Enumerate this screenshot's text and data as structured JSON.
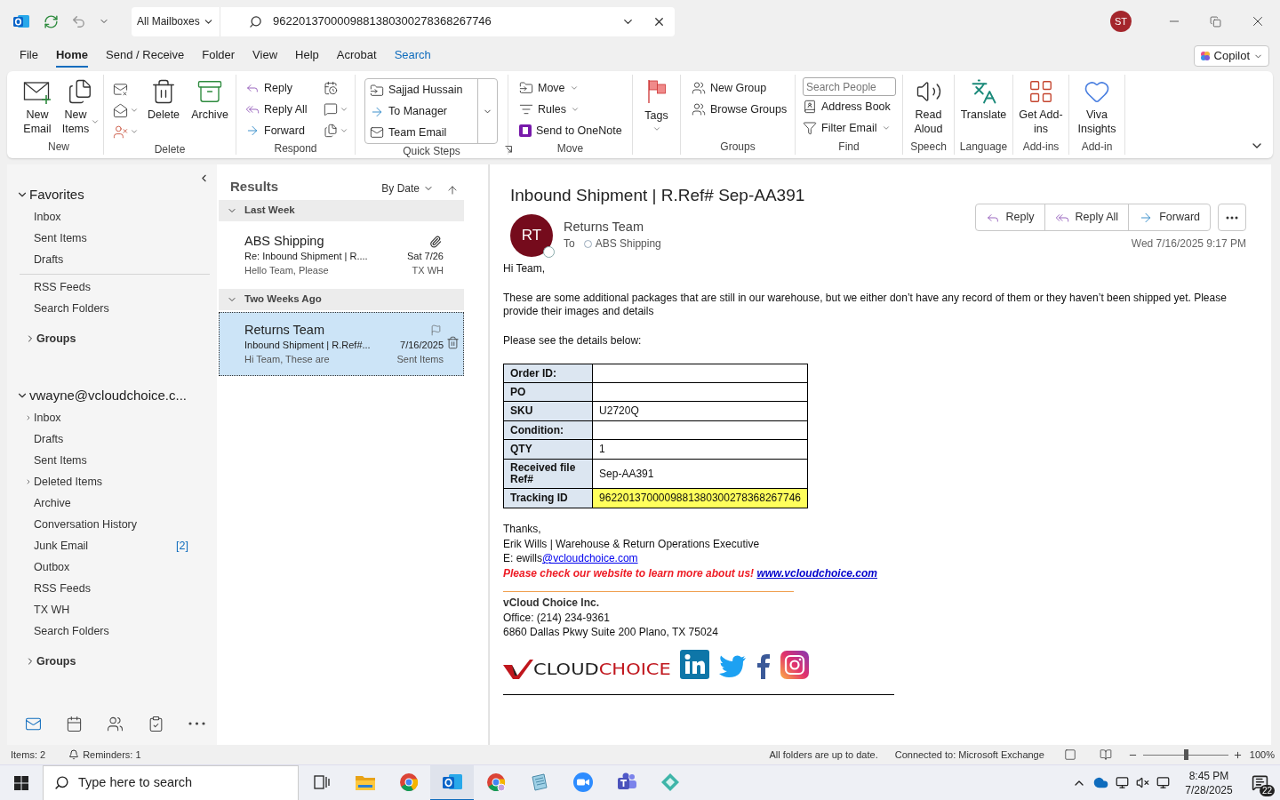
{
  "title_bar": {
    "search_scope": "All Mailboxes",
    "search_value": "9622013700009881380300278368267746",
    "account_initials": "ST"
  },
  "menu_tabs": [
    {
      "label": "File",
      "selected": false,
      "kind": "standard"
    },
    {
      "label": "Home",
      "selected": true,
      "kind": "standard"
    },
    {
      "label": "Send / Receive",
      "selected": false,
      "kind": "standard"
    },
    {
      "label": "Folder",
      "selected": false,
      "kind": "standard"
    },
    {
      "label": "View",
      "selected": false,
      "kind": "standard"
    },
    {
      "label": "Help",
      "selected": false,
      "kind": "standard"
    },
    {
      "label": "Acrobat",
      "selected": false,
      "kind": "standard"
    },
    {
      "label": "Search",
      "selected": false,
      "kind": "contextual"
    }
  ],
  "copilot": {
    "label": "Copilot"
  },
  "ribbon": {
    "groups": [
      {
        "label": "New",
        "kind": "large",
        "buttons": [
          "New Email",
          "New Items"
        ]
      },
      {
        "label": "Delete",
        "kind": "delete",
        "buttons": [
          "Delete",
          "Archive"
        ]
      },
      {
        "label": "Respond",
        "kind": "respond",
        "buttons": [
          "Reply",
          "Reply All",
          "Forward"
        ]
      },
      {
        "label": "Quick Steps",
        "kind": "gallery",
        "buttons": [
          "Sajjad Hussain",
          "To Manager",
          "Team Email"
        ]
      },
      {
        "label": "Move",
        "kind": "small",
        "buttons": [
          "Move",
          "Rules",
          "Send to OneNote"
        ]
      },
      {
        "kind": "tags",
        "buttons": [
          "Tags"
        ]
      },
      {
        "label": "Groups",
        "kind": "small",
        "buttons": [
          "New Group",
          "Browse Groups"
        ]
      },
      {
        "label": "Find",
        "kind": "find",
        "placeholder": "Search People",
        "buttons": [
          "Address Book",
          "Filter Email"
        ]
      },
      {
        "label": "Speech",
        "kind": "large",
        "buttons": [
          "Read Aloud"
        ]
      },
      {
        "label": "Language",
        "kind": "large",
        "buttons": [
          "Translate"
        ]
      },
      {
        "label": "Add-ins",
        "kind": "large",
        "buttons": [
          "Get Add-ins"
        ]
      },
      {
        "label": "Add-in",
        "kind": "large",
        "buttons": [
          "Viva Insights"
        ]
      }
    ]
  },
  "folder_pane": {
    "sections": [
      {
        "kind": "favorites",
        "label": "Favorites",
        "expanded": true,
        "folders": [
          {
            "label": "Inbox",
            "has_subfolders": false
          },
          {
            "label": "Sent Items",
            "has_subfolders": false
          },
          {
            "label": "Drafts",
            "has_subfolders": false
          }
        ]
      },
      {
        "kind": "plain",
        "folders": [
          {
            "label": "RSS Feeds",
            "has_subfolders": false
          },
          {
            "label": "Search Folders",
            "has_subfolders": false
          }
        ]
      },
      {
        "kind": "group",
        "label": "Groups",
        "expanded": false
      },
      {
        "kind": "account",
        "label": "vwayne@vcloudchoice.c...",
        "expanded": true,
        "folders": [
          {
            "label": "Inbox",
            "has_subfolders": true
          },
          {
            "label": "Drafts",
            "has_subfolders": false
          },
          {
            "label": "Sent Items",
            "has_subfolders": false
          },
          {
            "label": "Deleted Items",
            "has_subfolders": true
          },
          {
            "label": "Archive",
            "has_subfolders": false
          },
          {
            "label": "Conversation History",
            "has_subfolders": false
          },
          {
            "label": "Junk Email",
            "has_subfolders": false,
            "unread": "[2]"
          },
          {
            "label": "Outbox",
            "has_subfolders": false
          },
          {
            "label": "RSS Feeds",
            "has_subfolders": false
          },
          {
            "label": "TX WH",
            "has_subfolders": false
          },
          {
            "label": "Search Folders",
            "has_subfolders": false
          }
        ]
      },
      {
        "kind": "group",
        "label": "Groups",
        "expanded": false
      }
    ],
    "nav": [
      {
        "selected": true
      },
      {
        "selected": false
      },
      {
        "selected": false
      },
      {
        "selected": false
      },
      {
        "selected": false
      }
    ]
  },
  "message_list": {
    "title": "Results",
    "sort": "By Date",
    "groups": [
      {
        "label": "Last Week",
        "expanded": true,
        "messages": [
          {
            "sender": "ABS Shipping",
            "subject": "Re: Inbound Shipment | R....",
            "preview": "Hello Team,  Please",
            "date": "Sat 7/26",
            "folder": "TX WH",
            "attachment": true,
            "selected": false,
            "hover_actions": false
          }
        ]
      },
      {
        "label": "Two Weeks Ago",
        "expanded": true,
        "messages": [
          {
            "sender": "Returns Team",
            "subject": "Inbound Shipment | R.Ref#...",
            "preview": "Hi Team,  These are",
            "date": "7/16/2025",
            "folder": "Sent Items",
            "attachment": false,
            "selected": true,
            "hover_actions": true
          }
        ]
      }
    ]
  },
  "reading_pane": {
    "subject": "Inbound Shipment | R.Ref# Sep-AA391",
    "sender_initials": "RT",
    "sender": "Returns Team",
    "to_label": "To",
    "recipient": "ABS Shipping",
    "actions": [
      "Reply",
      "Reply All",
      "Forward"
    ],
    "date": "Wed 7/16/2025 9:17 PM",
    "body": {
      "greeting": "Hi Team,",
      "paragraph": "These are some additional packages that are still in our warehouse, but we either don’t have any record of them or they haven’t been shipped yet. Please provide their images and details",
      "intro": "Please see the details below:",
      "table": [
        {
          "label": "Order ID:",
          "highlighted": false
        },
        {
          "label": "PO",
          "highlighted": false
        },
        {
          "label": "SKU",
          "value": "U2720Q",
          "highlighted": false
        },
        {
          "label": "Condition:",
          "highlighted": false
        },
        {
          "label": "QTY",
          "value": "1",
          "highlighted": false
        },
        {
          "label": "Received file Ref#",
          "value": "Sep-AA391",
          "highlighted": false
        },
        {
          "label": "Tracking ID",
          "value": "9622013700009881380300278368267746",
          "highlighted": true
        }
      ],
      "signature": {
        "thanks": "Thanks,",
        "signer": "Erik Wills | Warehouse & Return Operations Executive",
        "email_prefix": "E: ewills",
        "email_link": "@vcloudchoice.com",
        "promo": "Please check our website to learn more about us!",
        "website": "www.vcloudchoice.com",
        "company": "vCloud Choice Inc.",
        "office": "Office: (214) 234-9361",
        "address": "6860 Dallas Pkwy Suite 200 Plano, TX 75024",
        "logo_part_1": "CLOUD",
        "logo_part_2": "CHOICE"
      }
    }
  },
  "status_bar": {
    "items": "Items: 2",
    "reminders": "Reminders: 1",
    "sync": "All folders are up to date.",
    "connection": "Connected to: Microsoft Exchange",
    "zoom": {
      "level": 0.5
    },
    "zoom_label": "100%"
  },
  "taskbar": {
    "search_placeholder": "Type here to search",
    "apps": [
      {
        "selected": false
      },
      {
        "selected": false
      },
      {
        "selected": false
      },
      {
        "selected": true
      },
      {
        "selected": false
      },
      {
        "selected": false
      },
      {
        "selected": false
      },
      {
        "selected": false
      },
      {
        "selected": false
      }
    ],
    "time": "8:45 PM",
    "date": "7/28/2025",
    "notifications": "22"
  }
}
